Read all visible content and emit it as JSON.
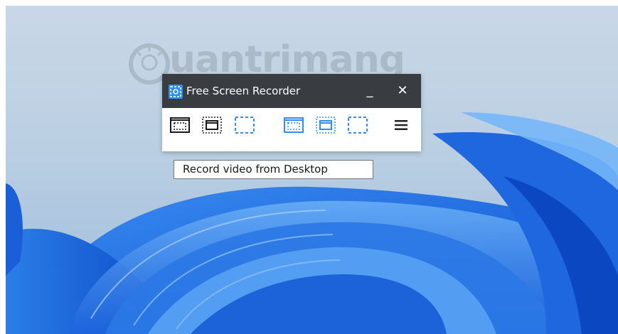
{
  "window": {
    "title": "Free Screen Recorder",
    "minimize_label": "_",
    "close_label": "✕"
  },
  "toolbar": {
    "video_group": [
      {
        "icon": "fullscreen-video-icon",
        "color": "#1a1a1a"
      },
      {
        "icon": "window-video-icon",
        "color": "#1a1a1a"
      },
      {
        "icon": "region-video-icon",
        "color": "#2f8ff2"
      }
    ],
    "screenshot_group": [
      {
        "icon": "fullscreen-screenshot-icon",
        "color": "#2f8ff2"
      },
      {
        "icon": "window-screenshot-icon",
        "color": "#2f8ff2"
      },
      {
        "icon": "region-screenshot-icon",
        "color": "#2f8ff2"
      }
    ],
    "menu_icon": "hamburger-menu-icon"
  },
  "tooltip": {
    "text": "Record video from Desktop"
  },
  "watermark": {
    "text": "uantrimang"
  },
  "colors": {
    "accent": "#2f8ff2",
    "titlebar": "#282c32",
    "wallpaper_blue": "#1e6fe0"
  }
}
